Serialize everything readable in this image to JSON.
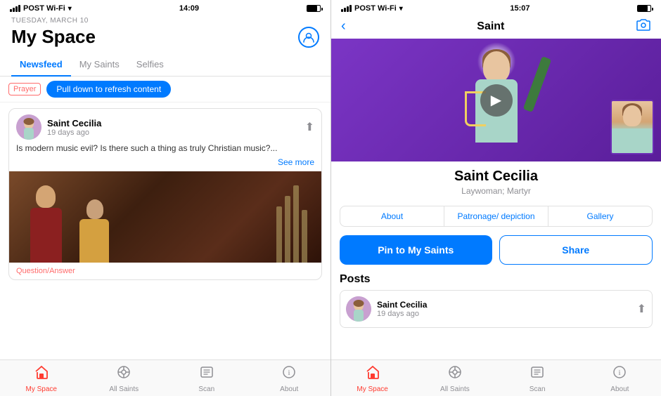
{
  "phone1": {
    "statusBar": {
      "carrier": "POST Wi-Fi",
      "time": "14:09",
      "wifi": "wifi"
    },
    "header": {
      "date": "TUESDAY, MARCH 10",
      "title": "My Space",
      "profileLabel": "profile"
    },
    "tabs": [
      {
        "label": "Newsfeed",
        "active": true
      },
      {
        "label": "My Saints",
        "active": false
      },
      {
        "label": "Selfies",
        "active": false
      }
    ],
    "pullRefresh": {
      "tag": "Prayer",
      "message": "Pull down to refresh content"
    },
    "feedCard": {
      "name": "Saint Cecilia",
      "time": "19 days ago",
      "text": "Is modern music evil? Is there such a thing as truly Christian music?...",
      "seeMore": "See more",
      "tag": "Question/Answer"
    },
    "bottomNav": [
      {
        "label": "My Space",
        "active": true,
        "icon": "⌂"
      },
      {
        "label": "All Saints",
        "active": false,
        "icon": "◎"
      },
      {
        "label": "Scan",
        "active": false,
        "icon": "📖"
      },
      {
        "label": "About",
        "active": false,
        "icon": "ℹ"
      }
    ]
  },
  "phone2": {
    "statusBar": {
      "carrier": "POST Wi-Fi",
      "time": "15:07",
      "wifi": "wifi"
    },
    "header": {
      "backLabel": "back",
      "title": "Saint",
      "cameraLabel": "camera"
    },
    "saint": {
      "name": "Saint Cecilia",
      "subtitle": "Laywoman; Martyr"
    },
    "detailTabs": [
      {
        "label": "About",
        "active": false
      },
      {
        "label": "Patronage/ depiction",
        "active": false
      },
      {
        "label": "Gallery",
        "active": false
      }
    ],
    "actions": {
      "pin": "Pin to My Saints",
      "share": "Share"
    },
    "posts": {
      "title": "Posts",
      "items": [
        {
          "name": "Saint Cecilia",
          "time": "19 days ago"
        }
      ]
    },
    "bottomNav": [
      {
        "label": "My Space",
        "active": true,
        "icon": "⌂"
      },
      {
        "label": "All Saints",
        "active": false,
        "icon": "◎"
      },
      {
        "label": "Scan",
        "active": false,
        "icon": "📖"
      },
      {
        "label": "About",
        "active": false,
        "icon": "ℹ"
      }
    ]
  }
}
